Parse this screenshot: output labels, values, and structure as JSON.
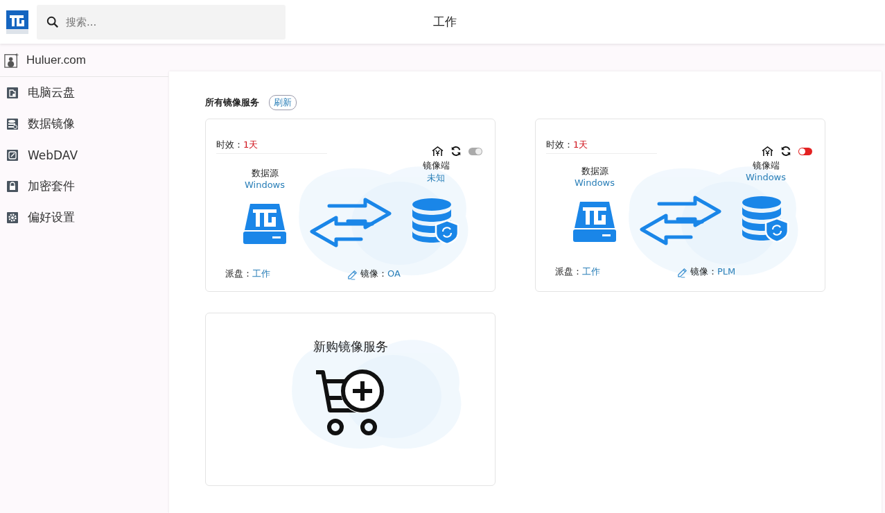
{
  "header": {
    "search": {
      "placeholder": "搜索..."
    },
    "title": "工作"
  },
  "sidebar": {
    "account": "Huluer.com",
    "items": [
      {
        "label": "电脑云盘"
      },
      {
        "label": "数据镜像"
      },
      {
        "label": "WebDAV"
      },
      {
        "label": "加密套件"
      },
      {
        "label": "偏好设置"
      }
    ]
  },
  "section": {
    "title": "所有镜像服务",
    "refresh": "刷新"
  },
  "services": [
    {
      "validity_label": "时效：",
      "validity": "1天",
      "on": true,
      "source_label": "数据源",
      "source": "Windows",
      "target_label": "镜像端",
      "target": "未知",
      "disk_label": "派盘：",
      "disk": "工作",
      "mirror_label": "镜像：",
      "mirror": "OA"
    },
    {
      "validity_label": "时效：",
      "validity": "1天",
      "on": false,
      "source_label": "数据源",
      "source": "Windows",
      "target_label": "镜像端",
      "target": "Windows",
      "disk_label": "派盘：",
      "disk": "工作",
      "mirror_label": "镜像：",
      "mirror": "PLM"
    }
  ],
  "purchase": {
    "label": "新购镜像服务"
  }
}
